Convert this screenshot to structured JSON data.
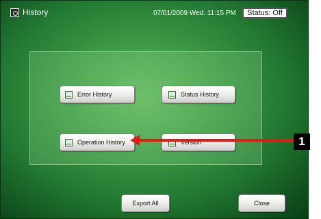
{
  "header": {
    "title": "History",
    "datetime": "07/01/2009 Wed. 11:15 PM",
    "status": "Status: Off"
  },
  "menu": {
    "error_history": "Error History",
    "status_history": "Status History",
    "operation_history": "Operation History",
    "version": "Version"
  },
  "footer": {
    "export_all": "Export All",
    "close": "Close"
  },
  "annotation": {
    "callout_number": "1",
    "arrow_color": "#e31b12"
  },
  "colors": {
    "background_green": "#3f9a46"
  }
}
